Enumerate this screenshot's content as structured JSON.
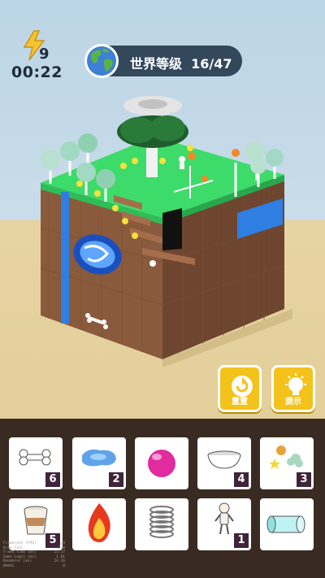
{
  "hud": {
    "energy_count": "9",
    "timer": "00:22",
    "level_label": "世界等级",
    "level_progress": "16/47",
    "globe_icon": "earth-globe-icon",
    "energy_icon": "lightning-bolt-icon"
  },
  "buttons": {
    "reset_label": "重置",
    "hint_label": "提示",
    "accent": "#f3c21b"
  },
  "inventory": [
    {
      "name": "bone",
      "icon": "bone-icon",
      "count": "6"
    },
    {
      "name": "water puddle",
      "icon": "water-puddle-icon",
      "count": "2"
    },
    {
      "name": "pink ball",
      "icon": "pink-ball-icon",
      "count": ""
    },
    {
      "name": "bowl",
      "icon": "bowl-icon",
      "count": "4"
    },
    {
      "name": "seeds and stars",
      "icon": "seed-star-icon",
      "count": "3"
    },
    {
      "name": "cup",
      "icon": "cup-icon",
      "count": "5"
    },
    {
      "name": "fire",
      "icon": "fire-icon",
      "count": ""
    },
    {
      "name": "spring",
      "icon": "spring-icon",
      "count": ""
    },
    {
      "name": "figure",
      "icon": "figure-icon",
      "count": "1"
    },
    {
      "name": "tube",
      "icon": "glass-tube-icon",
      "count": ""
    }
  ],
  "debug": [
    {
      "label": "Framerate (FPS)",
      "value": "39"
    },
    {
      "label": "Draw Call",
      "value": "250"
    },
    {
      "label": "Frame time (ms)",
      "value": "25.17"
    },
    {
      "label": "Game Logic (ms)",
      "value": "1.01"
    },
    {
      "label": "Renderer (ms)",
      "value": "24.16"
    },
    {
      "label": "WebGL",
      "value": "0"
    }
  ],
  "colors": {
    "sky": "#bcd5e6",
    "sand": "#e3cf9a",
    "grass": "#3ddc6a",
    "dirt": "#8a5a3c",
    "tray": "#3a2b22",
    "hud_pill": "#34485c"
  }
}
